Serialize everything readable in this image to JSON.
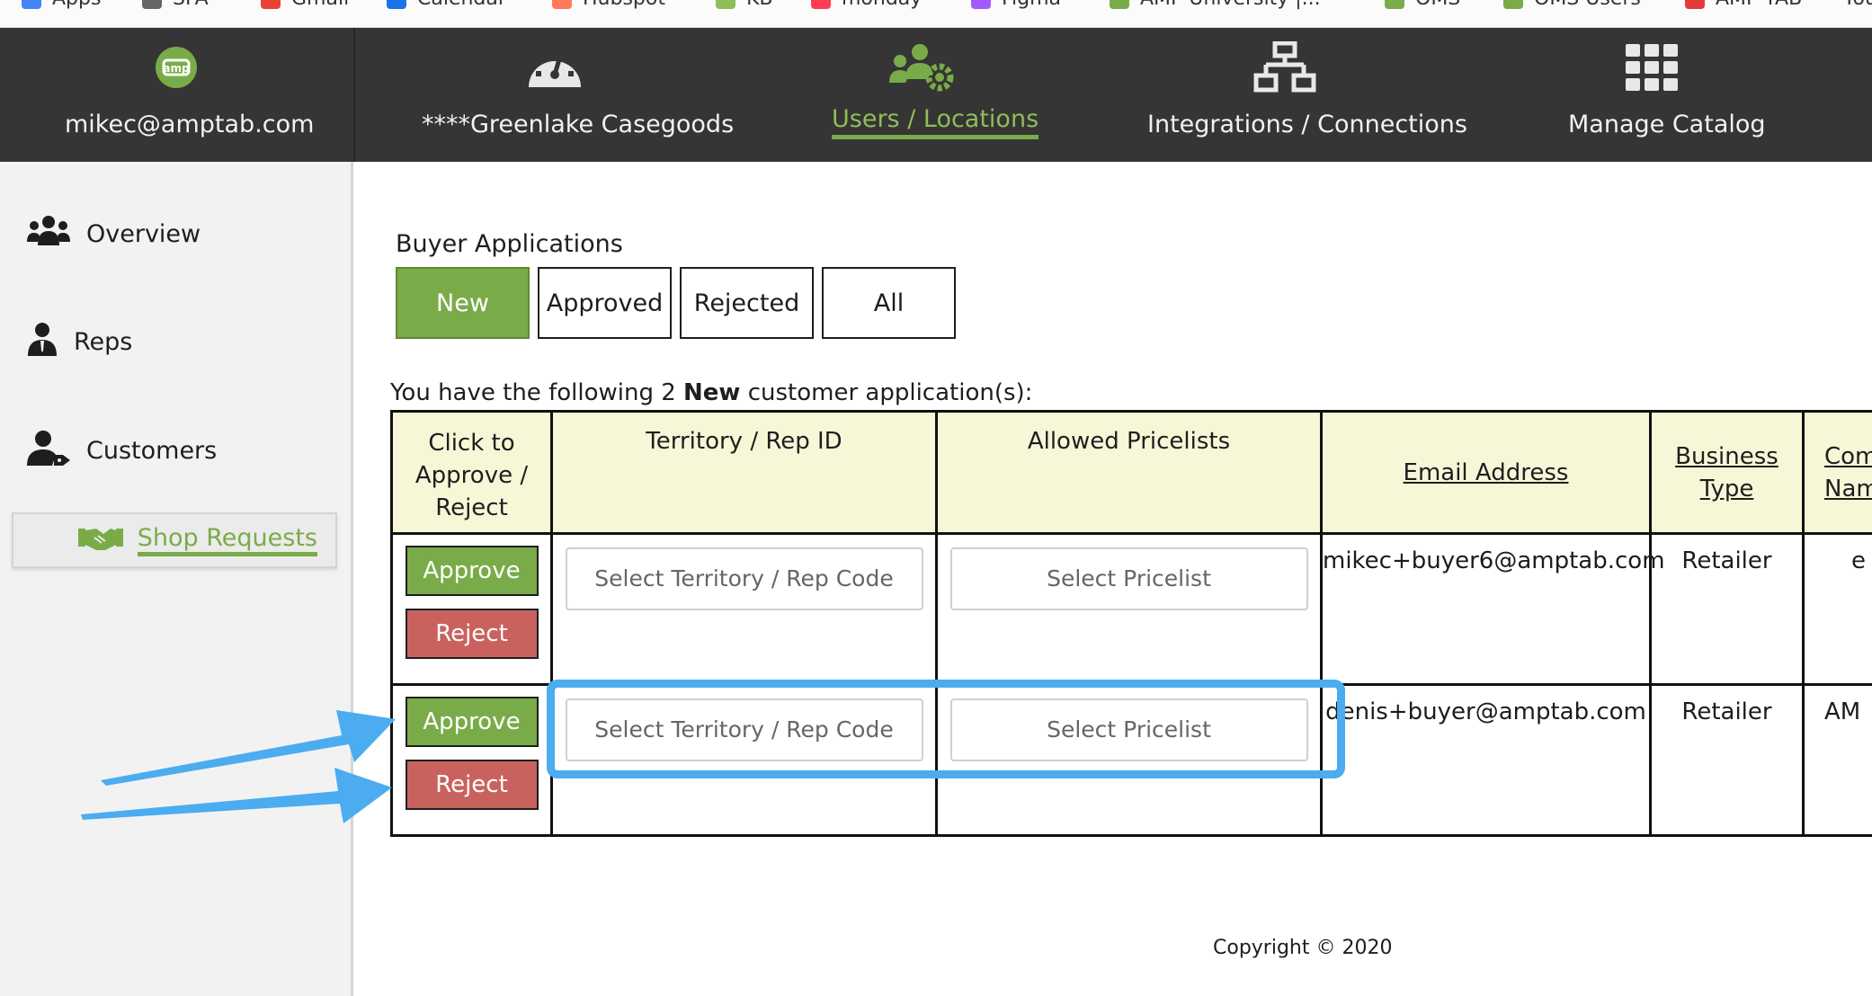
{
  "bookmarks": [
    "Apps",
    "SFA",
    "Gmail",
    "Calendar",
    "Hubspot",
    "KB",
    "monday",
    "Figma",
    "AMP University |...",
    "OMS",
    "OMS Users",
    "AMP TAB",
    "You"
  ],
  "topnav": {
    "account": "mikec@amptab.com",
    "items": [
      {
        "label": "****Greenlake Casegoods",
        "icon": "dashboard-gauge-icon"
      },
      {
        "label": "Users / Locations",
        "icon": "users-gear-icon",
        "active": true
      },
      {
        "label": "Integrations / Connections",
        "icon": "network-icon"
      },
      {
        "label": "Manage Catalog",
        "icon": "grid-icon"
      }
    ]
  },
  "sidebar": {
    "items": [
      {
        "label": "Overview",
        "icon": "users-group-icon"
      },
      {
        "label": "Reps",
        "icon": "rep-icon"
      },
      {
        "label": "Customers",
        "icon": "customer-tag-icon"
      }
    ],
    "active": {
      "label": "Shop Requests",
      "icon": "handshake-icon"
    }
  },
  "main": {
    "section_title": "Buyer Applications",
    "tabs": [
      {
        "label": "New",
        "active": true
      },
      {
        "label": "Approved"
      },
      {
        "label": "Rejected"
      },
      {
        "label": "All"
      }
    ],
    "summary_prefix": "You have the following 2 ",
    "summary_bold": "New",
    "summary_suffix": " customer application(s):"
  },
  "table": {
    "headers": {
      "action": "Click to Approve / Reject",
      "territory": "Territory / Rep ID",
      "pricelists": "Allowed Pricelists",
      "email": "Email Address",
      "business": "Business Type",
      "company": "Company Name"
    },
    "approve_label": "Approve",
    "reject_label": "Reject",
    "territory_placeholder": "Select Territory / Rep Code",
    "pricelist_placeholder": "Select Pricelist",
    "rows": [
      {
        "email": "mikec+buyer6@amptab.com",
        "business": "Retailer",
        "company": "e"
      },
      {
        "email": "denis+buyer@amptab.com",
        "business": "Retailer",
        "company": "AM"
      }
    ]
  },
  "footer": {
    "copyright": "Copyright © 2020"
  },
  "colors": {
    "accent_green": "#7aab49",
    "reject_red": "#c9625e",
    "nav_bg": "#353535",
    "highlight_blue": "#4bacf0",
    "header_yellow": "#f7f7d8"
  }
}
